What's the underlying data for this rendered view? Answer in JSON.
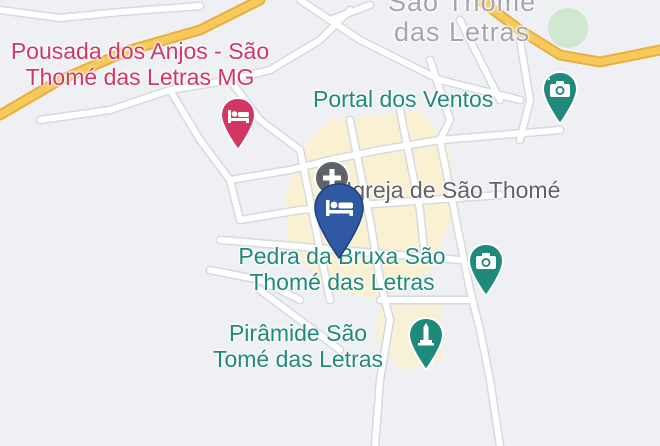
{
  "map": {
    "town_label": [
      "São Thomé",
      "das Letras"
    ],
    "colors": {
      "background": "#eef0f3",
      "road": "#ffffff",
      "road_outline": "#d6d9de",
      "highway": "#f7c85a",
      "highway_outline": "#e6b040",
      "center_area": "#fbf1cc",
      "park": "#cfe8cf",
      "hotel_red": "#d33665",
      "attraction_teal": "#1f8a7c",
      "selected_blue": "#2f5aa3",
      "medical_gray": "#5f6368"
    },
    "places": [
      {
        "key": "pousada",
        "name": [
          "Pousada dos Anjos - São",
          "Thomé das Letras MG"
        ],
        "category": "hotel",
        "icon": "bed-icon"
      },
      {
        "key": "portal",
        "name": [
          "Portal dos Ventos"
        ],
        "category": "tourist attraction",
        "icon": "camera-icon"
      },
      {
        "key": "igreja",
        "name": [
          "Igreja de São Thomé"
        ],
        "category": "church",
        "icon": "medical-cross-icon"
      },
      {
        "key": "pedra",
        "name": [
          "Pedra da Bruxa São",
          "Thomé das Letras"
        ],
        "category": "tourist attraction",
        "icon": "camera-icon"
      },
      {
        "key": "piramide",
        "name": [
          "Pirâmide São",
          "Tomé das Letras"
        ],
        "category": "monument",
        "icon": "monument-icon"
      }
    ],
    "selected_marker": {
      "category": "hotel",
      "icon": "bed-icon",
      "color": "#2f5aa3"
    }
  }
}
